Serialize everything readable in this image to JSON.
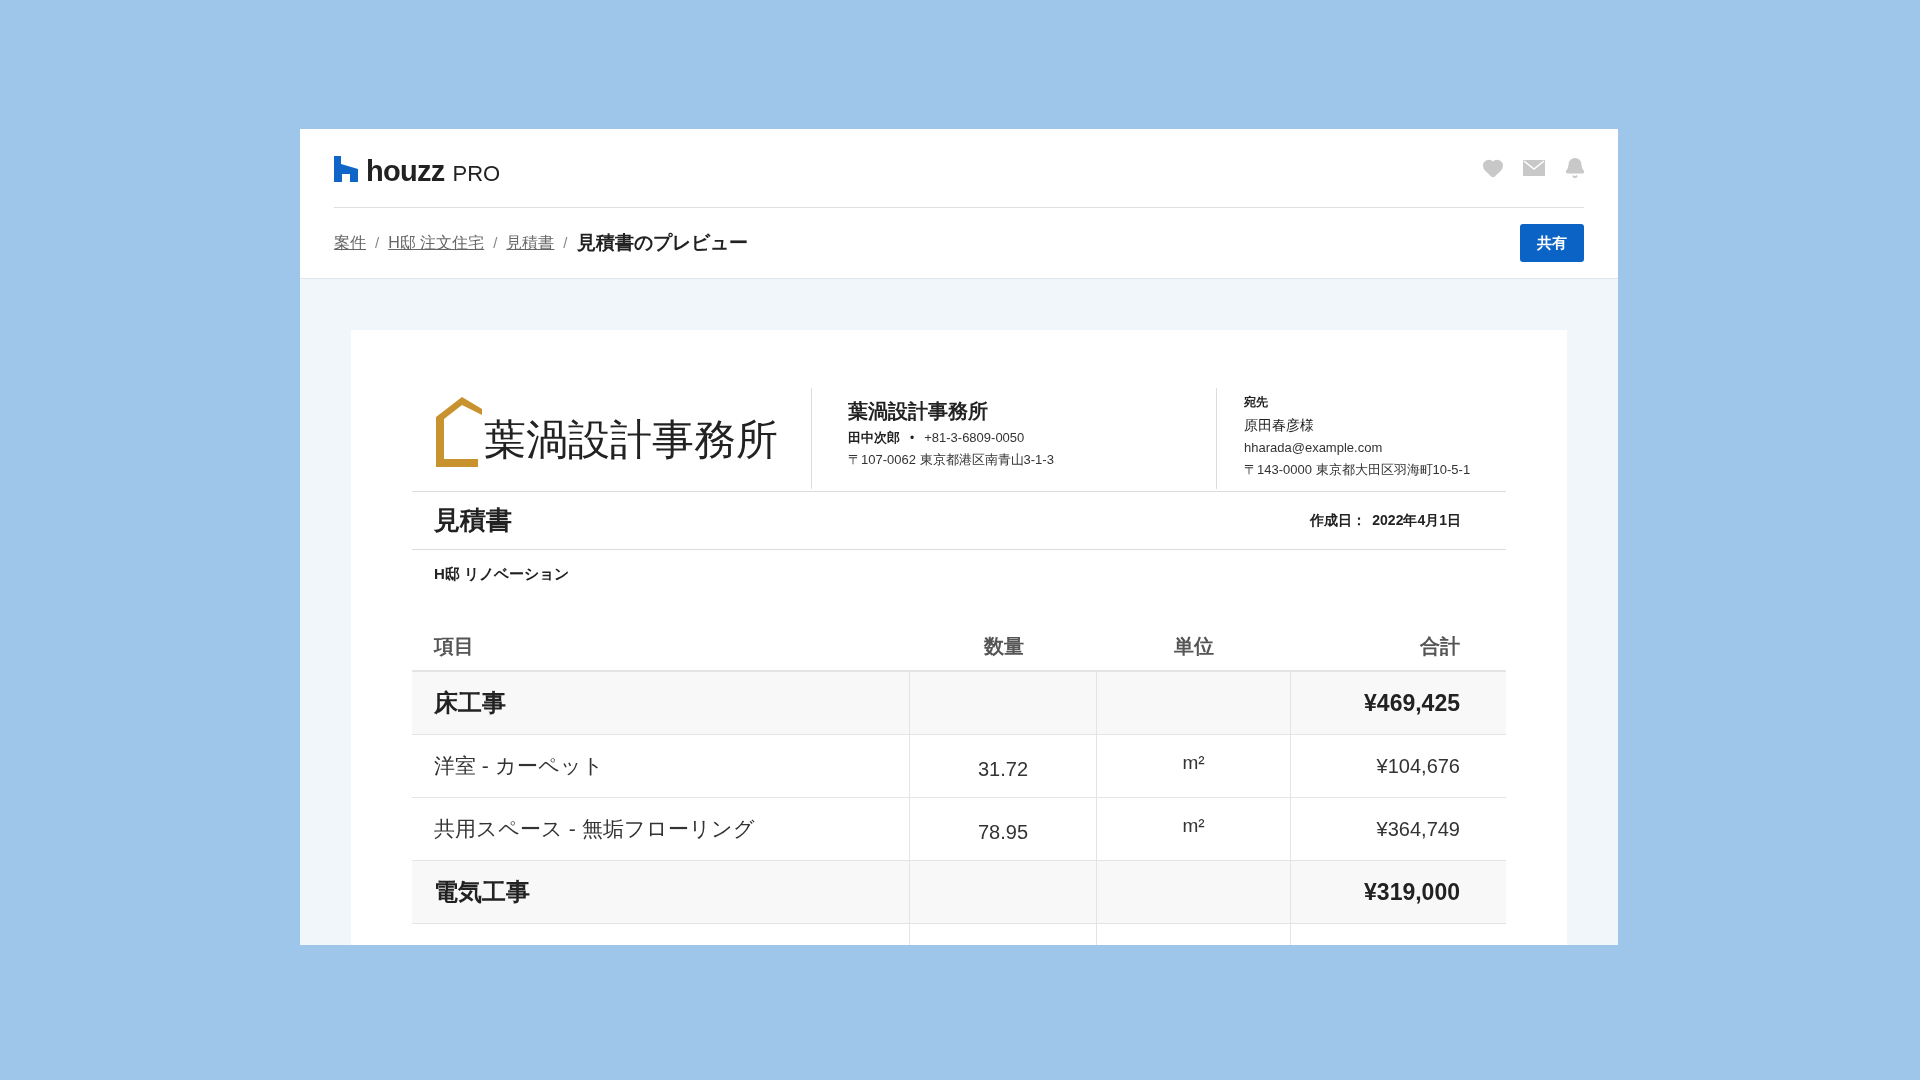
{
  "brand": {
    "name": "houzz",
    "suffix": "PRO"
  },
  "breadcrumb": [
    {
      "label": "案件",
      "link": true
    },
    {
      "label": "H邸 注文住宅",
      "link": true
    },
    {
      "label": "見積書",
      "link": true
    },
    {
      "label": "見積書のプレビュー",
      "link": false
    }
  ],
  "breadcrumb_separator": "/",
  "share_button": "共有",
  "document": {
    "logo_text": "葉渦設計事務所",
    "company": {
      "name": "葉渦設計事務所",
      "person": "田中次郎",
      "separator": "•",
      "phone": "+81-3-6809-0050",
      "address": "〒107-0062 東京都港区南青山3-1-3"
    },
    "recipient": {
      "label": "宛先",
      "name": "原田春彦様",
      "email": "hharada@example.com",
      "address": "〒143-0000 東京都大田区羽海町10-5-1"
    },
    "title": "見積書",
    "date_label": "作成日：",
    "date": "2022年4月1日",
    "project": "H邸 リノベーション",
    "table": {
      "columns": [
        "項目",
        "数量",
        "単位",
        "合計"
      ],
      "rows": [
        {
          "kind": "section",
          "item": "床工事",
          "total": "¥469,425"
        },
        {
          "kind": "item",
          "item": "洋室 - カーペット",
          "quantity": "31.72",
          "unit": "m²",
          "total": "¥104,676"
        },
        {
          "kind": "item",
          "item": "共用スペース - 無垢フローリング",
          "quantity": "78.95",
          "unit": "m²",
          "total": "¥364,749"
        },
        {
          "kind": "section",
          "item": "電気工事",
          "total": "¥319,000"
        }
      ]
    }
  }
}
